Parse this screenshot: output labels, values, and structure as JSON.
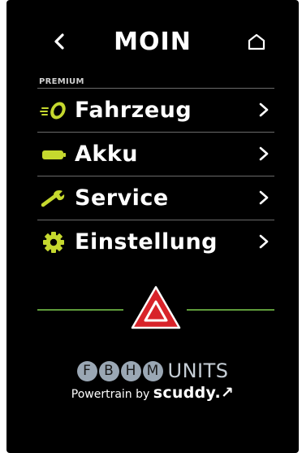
{
  "header": {
    "title": "MOIN",
    "back_icon": "chevron-left-icon",
    "home_icon": "home-icon"
  },
  "section_label": "PREMIUM",
  "menu": {
    "items": [
      {
        "label": "Fahrzeug",
        "icon": "speed-wheel-icon"
      },
      {
        "label": "Akku",
        "icon": "battery-icon"
      },
      {
        "label": "Service",
        "icon": "wrench-icon"
      },
      {
        "label": "Einstellung",
        "icon": "gear-icon"
      }
    ],
    "chevron_icon": "chevron-right-icon",
    "icon_color": "#c5d82e"
  },
  "hazard": {
    "icon": "hazard-triangle-icon",
    "color": "#d8232a",
    "line_color": "#5e9a3a"
  },
  "brand": {
    "letters": [
      "F",
      "B",
      "H",
      "M"
    ],
    "units": "UNITS",
    "powertrain_by": "Powertrain by",
    "company": "scuddy.↗"
  }
}
